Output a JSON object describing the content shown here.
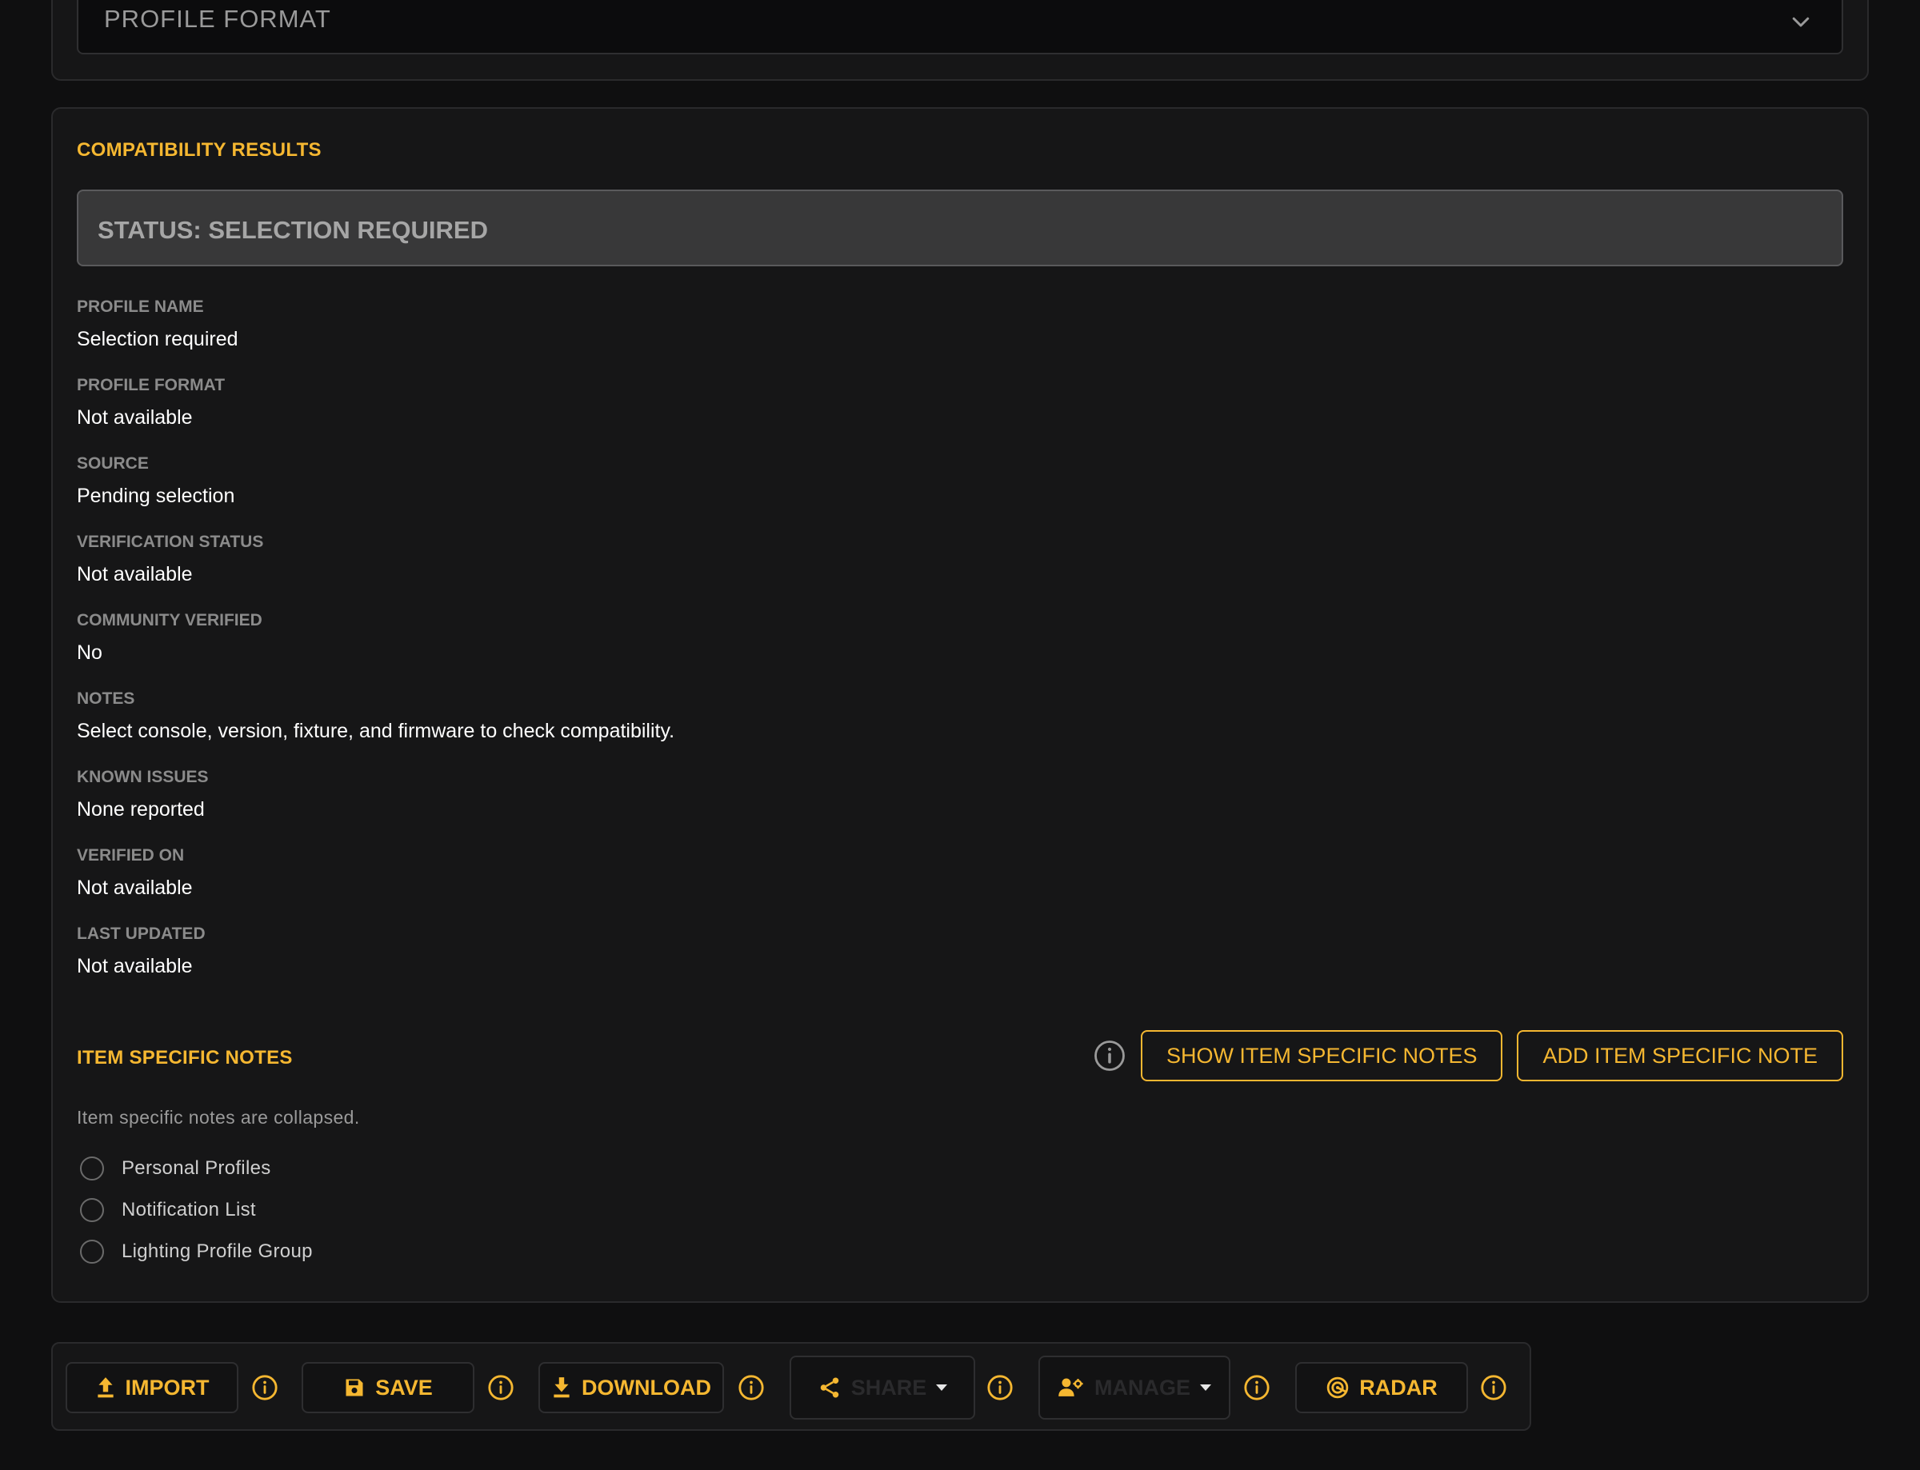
{
  "profile_format_select": {
    "placeholder": "PROFILE FORMAT",
    "icon": "chevron-down-icon"
  },
  "results": {
    "title": "COMPATIBILITY RESULTS",
    "status": "STATUS: SELECTION REQUIRED",
    "fields": [
      {
        "label": "PROFILE NAME",
        "value": "Selection required"
      },
      {
        "label": "PROFILE FORMAT",
        "value": "Not available"
      },
      {
        "label": "SOURCE",
        "value": "Pending selection"
      },
      {
        "label": "VERIFICATION STATUS",
        "value": "Not available"
      },
      {
        "label": "COMMUNITY VERIFIED",
        "value": "No"
      },
      {
        "label": "NOTES",
        "value": "Select console, version, fixture, and firmware to check compatibility."
      },
      {
        "label": "KNOWN ISSUES",
        "value": "None reported"
      },
      {
        "label": "VERIFIED ON",
        "value": "Not available"
      },
      {
        "label": "LAST UPDATED",
        "value": "Not available"
      }
    ]
  },
  "item_notes": {
    "title": "ITEM SPECIFIC NOTES",
    "show_button": "SHOW ITEM SPECIFIC NOTES",
    "add_button": "ADD ITEM SPECIFIC NOTE",
    "collapsed_message": "Item specific notes are collapsed.",
    "options": [
      "Personal Profiles",
      "Notification List",
      "Lighting Profile Group"
    ]
  },
  "toolbar": {
    "import": "IMPORT",
    "save": "SAVE",
    "download": "DOWNLOAD",
    "share": "SHARE",
    "manage": "MANAGE",
    "radar": "RADAR"
  },
  "colors": {
    "accent": "#f5b731",
    "background": "#0f0f10",
    "card": "#161617"
  }
}
